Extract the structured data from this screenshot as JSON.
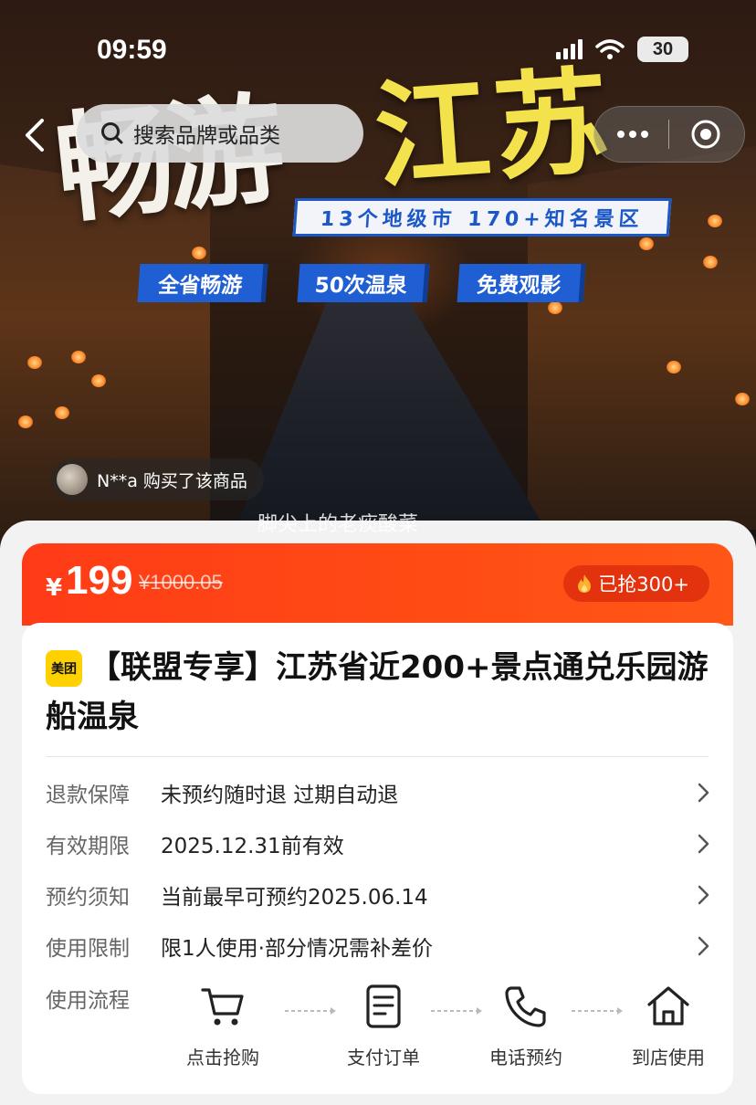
{
  "status_bar": {
    "time": "09:59",
    "battery": "30"
  },
  "nav": {
    "search_placeholder": "搜索品牌或品类"
  },
  "hero": {
    "brush_white": "畅游",
    "brush_yellow": "江苏",
    "sub_banner": "13个地级市 170+知名景区",
    "tags": [
      "全省畅游",
      "50次温泉",
      "免费观影"
    ],
    "purchase_ticker": "N**a 购买了该商品",
    "watermark": "脚尖上的老痰酸菜"
  },
  "price": {
    "currency": "¥",
    "current": "199",
    "original": "¥1000.05",
    "sold": "已抢300+"
  },
  "product": {
    "brand_badge": "美团",
    "title": "【联盟专享】江苏省近200+景点通兑乐园游船温泉"
  },
  "info_rows": [
    {
      "label": "退款保障",
      "value": "未预约随时退 过期自动退"
    },
    {
      "label": "有效期限",
      "value": "2025.12.31前有效"
    },
    {
      "label": "预约须知",
      "value": "当前最早可预约2025.06.14"
    },
    {
      "label": "使用限制",
      "value": "限1人使用·部分情况需补差价"
    }
  ],
  "usage_flow": {
    "label": "使用流程",
    "steps": [
      {
        "icon": "cart-icon",
        "label": "点击抢购"
      },
      {
        "icon": "receipt-icon",
        "label": "支付订单"
      },
      {
        "icon": "phone-icon",
        "label": "电话预约"
      },
      {
        "icon": "home-icon",
        "label": "到店使用"
      }
    ]
  },
  "colors": {
    "accent": "#ff4c14",
    "brand_yellow": "#ffd100",
    "tag_blue": "#1f5fd3",
    "title_yellow": "#f3e24b"
  }
}
